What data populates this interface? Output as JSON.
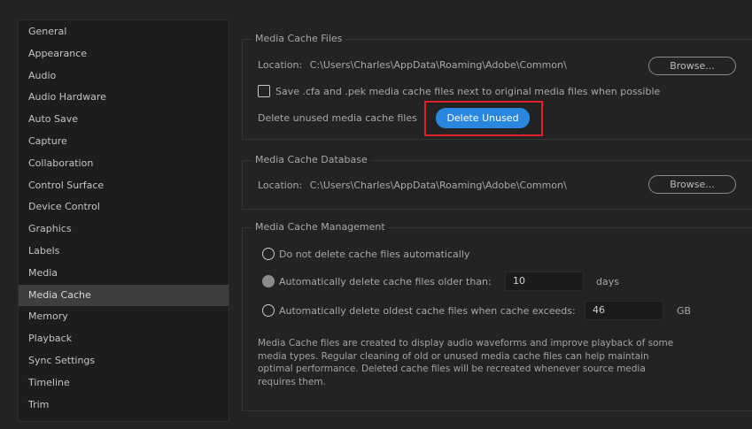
{
  "sidebar": {
    "items": [
      {
        "label": "General"
      },
      {
        "label": "Appearance"
      },
      {
        "label": "Audio"
      },
      {
        "label": "Audio Hardware"
      },
      {
        "label": "Auto Save"
      },
      {
        "label": "Capture"
      },
      {
        "label": "Collaboration"
      },
      {
        "label": "Control Surface"
      },
      {
        "label": "Device Control"
      },
      {
        "label": "Graphics"
      },
      {
        "label": "Labels"
      },
      {
        "label": "Media"
      },
      {
        "label": "Media Cache",
        "selected": true
      },
      {
        "label": "Memory"
      },
      {
        "label": "Playback"
      },
      {
        "label": "Sync Settings"
      },
      {
        "label": "Timeline"
      },
      {
        "label": "Trim"
      }
    ]
  },
  "media_cache_files": {
    "title": "Media Cache Files",
    "location_label": "Location:",
    "location_path": "C:\\Users\\Charles\\AppData\\Roaming\\Adobe\\Common\\",
    "browse_label": "Browse...",
    "save_checkbox_label": "Save .cfa and .pek media cache files next to original media files when possible",
    "save_checkbox_checked": false,
    "delete_unused_label": "Delete unused media cache files",
    "delete_unused_button": "Delete Unused"
  },
  "media_cache_database": {
    "title": "Media Cache Database",
    "location_label": "Location:",
    "location_path": "C:\\Users\\Charles\\AppData\\Roaming\\Adobe\\Common\\",
    "browse_label": "Browse..."
  },
  "media_cache_management": {
    "title": "Media Cache Management",
    "option_none": "Do not delete cache files automatically",
    "option_older": "Automatically delete cache files older than:",
    "older_value": "10",
    "older_unit": "days",
    "option_exceeds": "Automatically delete oldest cache files when cache exceeds:",
    "exceeds_value": "46",
    "exceeds_unit": "GB",
    "description": "Media Cache files are created to display audio waveforms and improve playback of some media types.  Regular cleaning of old or unused media cache files can help maintain optimal performance. Deleted cache files will be recreated whenever source media requires them."
  },
  "colors": {
    "accent": "#2a87e0",
    "highlight": "#e1202a",
    "background": "#232323"
  }
}
